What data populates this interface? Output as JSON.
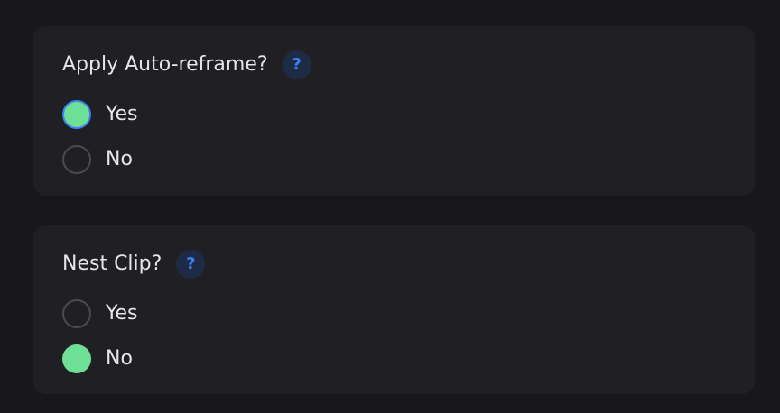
{
  "auto_reframe": {
    "question": "Apply Auto-reframe?",
    "help_glyph": "?",
    "options": [
      {
        "label": "Yes",
        "selected": true
      },
      {
        "label": "No",
        "selected": false
      }
    ]
  },
  "nest_clip": {
    "question": "Nest Clip?",
    "help_glyph": "?",
    "options": [
      {
        "label": "Yes",
        "selected": false
      },
      {
        "label": "No",
        "selected": true
      }
    ]
  },
  "colors": {
    "background": "#18181b",
    "card": "#202024",
    "selected_radio": "#6ee095",
    "focus_ring": "#3b82f6",
    "help_icon": "#3d7ef5"
  }
}
